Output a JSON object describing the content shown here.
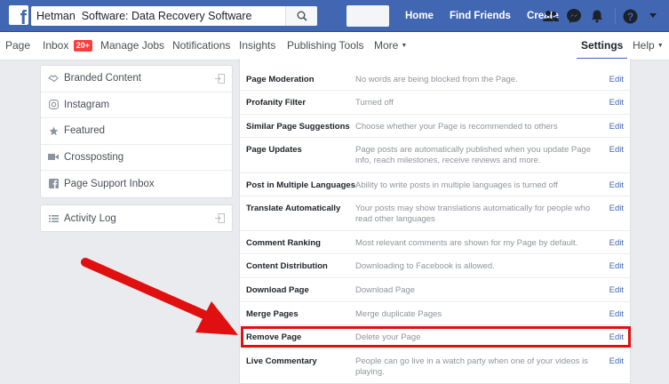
{
  "topbar": {
    "search_value": "Hetman  Software: Data Recovery Software",
    "nav": [
      "Home",
      "Find Friends",
      "Create"
    ],
    "icons": [
      "friends-icon",
      "messenger-icon",
      "notifications-icon",
      "help-icon",
      "dropdown-icon"
    ]
  },
  "subnav": {
    "page": "Page",
    "inbox": "Inbox",
    "inbox_badge": "20+",
    "manage_jobs": "Manage Jobs",
    "notifications": "Notifications",
    "insights": "Insights",
    "publishing_tools": "Publishing Tools",
    "more": "More",
    "settings": "Settings",
    "help": "Help"
  },
  "sidebar": {
    "items": [
      {
        "label": "Branded Content",
        "icon": "handshake-icon"
      },
      {
        "label": "Instagram",
        "icon": "instagram-icon"
      },
      {
        "label": "Featured",
        "icon": "star-icon"
      },
      {
        "label": "Crossposting",
        "icon": "video-icon"
      },
      {
        "label": "Page Support Inbox",
        "icon": "facebook-icon"
      }
    ],
    "activity_log": "Activity Log"
  },
  "settings": {
    "edit_label": "Edit",
    "rows": [
      {
        "label": "Page Moderation",
        "desc": "No words are being blocked from the Page."
      },
      {
        "label": "Profanity Filter",
        "desc": "Turned off"
      },
      {
        "label": "Similar Page Suggestions",
        "desc": "Choose whether your Page is recommended to others"
      },
      {
        "label": "Page Updates",
        "desc": "Page posts are automatically published when you update Page info, reach milestones, receive reviews and more."
      },
      {
        "label": "Post in Multiple Languages",
        "desc": "Ability to write posts in multiple languages is turned off"
      },
      {
        "label": "Translate Automatically",
        "desc": "Your posts may show translations automatically for people who read other languages"
      },
      {
        "label": "Comment Ranking",
        "desc": "Most relevant comments are shown for my Page by default."
      },
      {
        "label": "Content Distribution",
        "desc": "Downloading to Facebook is allowed."
      },
      {
        "label": "Download Page",
        "desc": "Download Page"
      },
      {
        "label": "Merge Pages",
        "desc": "Merge duplicate Pages"
      },
      {
        "label": "Remove Page",
        "desc": "Delete your Page"
      },
      {
        "label": "Live Commentary",
        "desc": "People can go live in a watch party when one of your videos is playing."
      }
    ]
  },
  "colors": {
    "brand_blue": "#4267b2",
    "highlight_red": "#e01010"
  }
}
